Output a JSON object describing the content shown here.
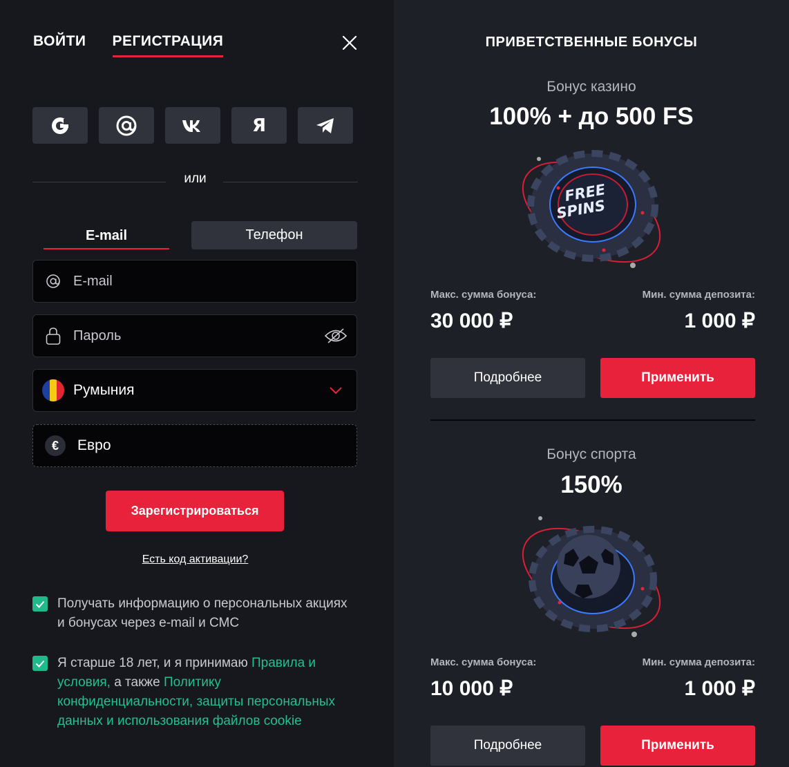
{
  "auth": {
    "tab_login": "ВОЙТИ",
    "tab_register": "РЕГИСТРАЦИЯ",
    "socials": {
      "yandex_label": "Я"
    },
    "or_label": "или",
    "method_tabs": {
      "email": "E-mail",
      "phone": "Телефон"
    },
    "email_field": {
      "placeholder": "E-mail"
    },
    "password_field": {
      "placeholder": "Пароль"
    },
    "country_field": {
      "value": "Румыния"
    },
    "currency_field": {
      "value": "Евро",
      "symbol": "€"
    },
    "register_button": "Зарегистрироваться",
    "activation_link": "Есть код активации?",
    "consent_promo": "Получать информацию о персональных акциях и бонусах через e-mail и СМС",
    "consent_age": {
      "prefix": "Я старше 18 лет, и я принимаю ",
      "rules_link": "Правила и условия,",
      "middle": " а также ",
      "privacy_link": "Политику конфиденциальности, защиты персональных данных и использования файлов cookie"
    }
  },
  "bonuses": {
    "title": "ПРИВЕТСТВЕННЫЕ БОНУСЫ",
    "casino": {
      "label": "Бонус казино",
      "value": "100% + до 500 FS",
      "chip_text": [
        "FREE",
        "SPINS"
      ],
      "max_label": "Макс. сумма бонуса:",
      "max_amount": "30 000 ₽",
      "min_label": "Мин. сумма депозита:",
      "min_amount": "1 000 ₽",
      "more_button": "Подробнее",
      "apply_button": "Применить"
    },
    "sport": {
      "label": "Бонус спорта",
      "value": "150%",
      "max_label": "Макс. сумма бонуса:",
      "max_amount": "10 000 ₽",
      "min_label": "Мин. сумма депозита:",
      "min_amount": "1 000 ₽",
      "more_button": "Подробнее",
      "apply_button": "Применить"
    }
  },
  "colors": {
    "accent": "#e8223a",
    "check": "#20b98a",
    "link": "#21c18f",
    "panel_left": "#17181d",
    "panel_right": "#1e2028"
  }
}
